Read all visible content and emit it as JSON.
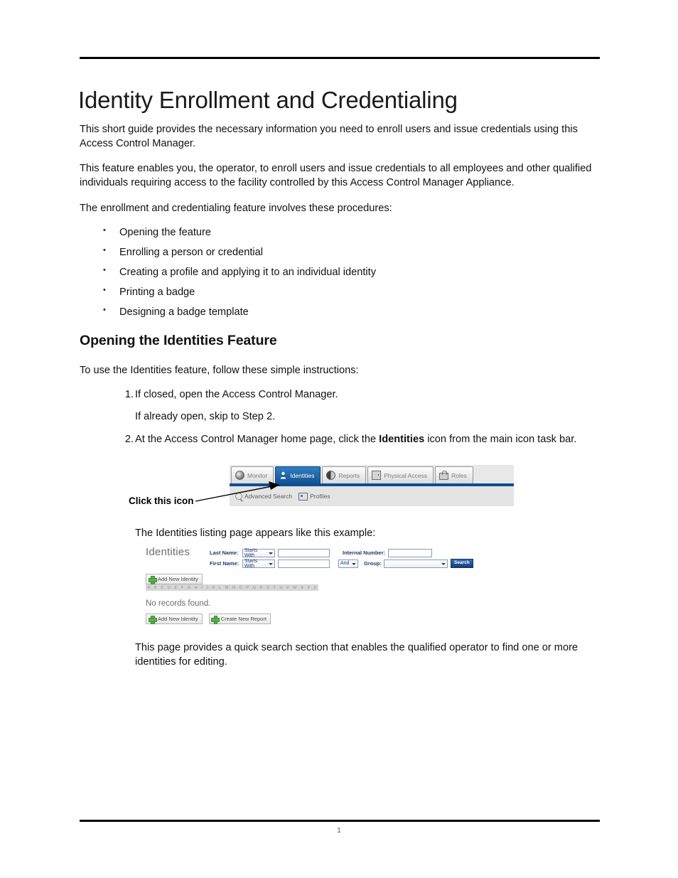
{
  "document": {
    "title": "Identity Enrollment and Credentialing",
    "page_number": "1"
  },
  "intro": {
    "para1": "This short guide provides the necessary information you need to enroll users and issue credentials using this Access Control Manager.",
    "para2": "This feature enables you, the operator, to enroll users and issue credentials to all employees and other qualified individuals requiring access to the facility controlled by this Access Control Manager Appliance.",
    "para3": "The enrollment and credentialing feature involves these procedures:"
  },
  "procedures": [
    "Opening the feature",
    "Enrolling a person or credential",
    "Creating a profile and applying it to an individual identity",
    "Printing a badge",
    "Designing a badge template"
  ],
  "section": {
    "heading": "Opening the Identities Feature",
    "lead": "To use the Identities feature, follow these simple instructions:",
    "step1_num": "1.",
    "step1_text": "If closed, open the Access Control Manager.",
    "step1_sub": "If already open, skip to Step 2.",
    "step2_num": "2.",
    "step2_prefix": "At the Access Control Manager home page, click the ",
    "step2_bold": "Identities",
    "step2_suffix": " icon from the main icon task bar.",
    "caption_listing": "The Identities listing page appears like this example:",
    "closing": "This page provides a quick search section that enables the qualified operator to find one or more identities for editing."
  },
  "annotation": {
    "click_this_icon": "Click this icon"
  },
  "toolbar_screenshot": {
    "tabs": [
      {
        "label": "Monitor",
        "icon": "camera-icon",
        "active": false
      },
      {
        "label": "Identities",
        "icon": "person-icon",
        "active": true
      },
      {
        "label": "Reports",
        "icon": "globe-icon",
        "active": false
      },
      {
        "label": "Physical Access",
        "icon": "door-icon",
        "active": false
      },
      {
        "label": "Roles",
        "icon": "lock-icon",
        "active": false
      }
    ],
    "subitems": [
      {
        "label": "Advanced Search",
        "icon": "magnifier-icon"
      },
      {
        "label": "Profiles",
        "icon": "id-card-icon"
      }
    ],
    "active_tab_color": "#14528f",
    "bar_color": "#0c4f93"
  },
  "identities_screenshot": {
    "heading": "Identities",
    "fields": {
      "last_name_label": "Last Name:",
      "last_name_operator": "Starts With",
      "last_name_value": "",
      "first_name_label": "First Name:",
      "first_name_operator": "Starts With",
      "first_name_value": "",
      "internal_number_label": "Internal Number:",
      "internal_number_value": "",
      "conjunction": "And",
      "group_label": "Group:",
      "group_value": ""
    },
    "search_button": "Search",
    "add_new_identity": "Add New Identity",
    "create_new_report": "Create New Report",
    "alphabet": [
      "A",
      "B",
      "C",
      "D",
      "E",
      "F",
      "G",
      "H",
      "I",
      "J",
      "K",
      "L",
      "M",
      "N",
      "O",
      "P",
      "Q",
      "R",
      "S",
      "T",
      "U",
      "V",
      "W",
      "X",
      "Y",
      "Z"
    ],
    "no_records": "No records found.",
    "search_button_color": "#17407c"
  }
}
